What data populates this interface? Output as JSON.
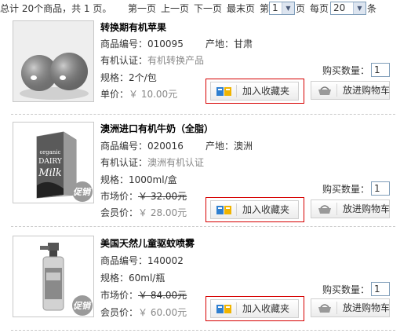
{
  "pager": {
    "summary": "总计 20个商品，共 1 页。",
    "first": "第一页",
    "prev": "上一页",
    "next": "下一页",
    "last": "最末页",
    "page_prefix": "第",
    "page_value": "1",
    "page_suffix": "页",
    "per_page_label": "每页",
    "per_page_value": "20",
    "per_page_suffix": "条"
  },
  "labels": {
    "code": "商品编号：",
    "origin": "产地：",
    "organic": "有机认证：",
    "spec": "规格：",
    "unit_price": "单价：",
    "market_price": "市场价：",
    "member_price": "会员价：",
    "qty": "购买数量：",
    "favorite": "加入收藏夹",
    "cart": "放进购物车"
  },
  "products": [
    {
      "name": "转换期有机苹果",
      "code": "010095",
      "origin": "甘肃",
      "organic": "有机转换产品",
      "spec": "2个/包",
      "unit_price": "￥ 10.00元",
      "qty": "1",
      "image": "apples-photo"
    },
    {
      "name": "澳洲进口有机牛奶（全脂）",
      "code": "020016",
      "origin": "澳洲",
      "organic": "澳洲有机认证",
      "spec": "1000ml/盒",
      "market_price": "￥ 32.00元",
      "member_price": "￥ 28.00元",
      "qty": "1",
      "image": "milk-carton-photo",
      "badge": "促销"
    },
    {
      "name": "美国天然儿童驱蚊喷雾",
      "code": "140002",
      "spec": "60ml/瓶",
      "market_price": "￥ 84.00元",
      "member_price": "￥ 60.00元",
      "qty": "1",
      "image": "spray-bottle-photo",
      "badge": "促销"
    }
  ],
  "colors": {
    "highlight_border": "#d60000",
    "muted_text": "#888888"
  }
}
